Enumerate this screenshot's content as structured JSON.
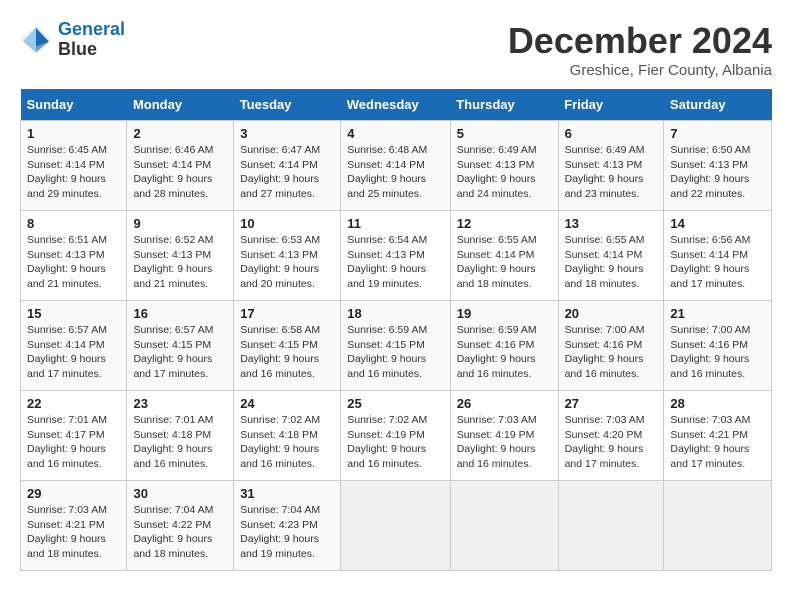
{
  "header": {
    "logo_line1": "General",
    "logo_line2": "Blue",
    "month_title": "December 2024",
    "subtitle": "Greshice, Fier County, Albania"
  },
  "days_of_week": [
    "Sunday",
    "Monday",
    "Tuesday",
    "Wednesday",
    "Thursday",
    "Friday",
    "Saturday"
  ],
  "weeks": [
    [
      {
        "day": "1",
        "info": "Sunrise: 6:45 AM\nSunset: 4:14 PM\nDaylight: 9 hours\nand 29 minutes."
      },
      {
        "day": "2",
        "info": "Sunrise: 6:46 AM\nSunset: 4:14 PM\nDaylight: 9 hours\nand 28 minutes."
      },
      {
        "day": "3",
        "info": "Sunrise: 6:47 AM\nSunset: 4:14 PM\nDaylight: 9 hours\nand 27 minutes."
      },
      {
        "day": "4",
        "info": "Sunrise: 6:48 AM\nSunset: 4:14 PM\nDaylight: 9 hours\nand 25 minutes."
      },
      {
        "day": "5",
        "info": "Sunrise: 6:49 AM\nSunset: 4:13 PM\nDaylight: 9 hours\nand 24 minutes."
      },
      {
        "day": "6",
        "info": "Sunrise: 6:49 AM\nSunset: 4:13 PM\nDaylight: 9 hours\nand 23 minutes."
      },
      {
        "day": "7",
        "info": "Sunrise: 6:50 AM\nSunset: 4:13 PM\nDaylight: 9 hours\nand 22 minutes."
      }
    ],
    [
      {
        "day": "8",
        "info": "Sunrise: 6:51 AM\nSunset: 4:13 PM\nDaylight: 9 hours\nand 21 minutes."
      },
      {
        "day": "9",
        "info": "Sunrise: 6:52 AM\nSunset: 4:13 PM\nDaylight: 9 hours\nand 21 minutes."
      },
      {
        "day": "10",
        "info": "Sunrise: 6:53 AM\nSunset: 4:13 PM\nDaylight: 9 hours\nand 20 minutes."
      },
      {
        "day": "11",
        "info": "Sunrise: 6:54 AM\nSunset: 4:13 PM\nDaylight: 9 hours\nand 19 minutes."
      },
      {
        "day": "12",
        "info": "Sunrise: 6:55 AM\nSunset: 4:14 PM\nDaylight: 9 hours\nand 18 minutes."
      },
      {
        "day": "13",
        "info": "Sunrise: 6:55 AM\nSunset: 4:14 PM\nDaylight: 9 hours\nand 18 minutes."
      },
      {
        "day": "14",
        "info": "Sunrise: 6:56 AM\nSunset: 4:14 PM\nDaylight: 9 hours\nand 17 minutes."
      }
    ],
    [
      {
        "day": "15",
        "info": "Sunrise: 6:57 AM\nSunset: 4:14 PM\nDaylight: 9 hours\nand 17 minutes."
      },
      {
        "day": "16",
        "info": "Sunrise: 6:57 AM\nSunset: 4:15 PM\nDaylight: 9 hours\nand 17 minutes."
      },
      {
        "day": "17",
        "info": "Sunrise: 6:58 AM\nSunset: 4:15 PM\nDaylight: 9 hours\nand 16 minutes."
      },
      {
        "day": "18",
        "info": "Sunrise: 6:59 AM\nSunset: 4:15 PM\nDaylight: 9 hours\nand 16 minutes."
      },
      {
        "day": "19",
        "info": "Sunrise: 6:59 AM\nSunset: 4:16 PM\nDaylight: 9 hours\nand 16 minutes."
      },
      {
        "day": "20",
        "info": "Sunrise: 7:00 AM\nSunset: 4:16 PM\nDaylight: 9 hours\nand 16 minutes."
      },
      {
        "day": "21",
        "info": "Sunrise: 7:00 AM\nSunset: 4:16 PM\nDaylight: 9 hours\nand 16 minutes."
      }
    ],
    [
      {
        "day": "22",
        "info": "Sunrise: 7:01 AM\nSunset: 4:17 PM\nDaylight: 9 hours\nand 16 minutes."
      },
      {
        "day": "23",
        "info": "Sunrise: 7:01 AM\nSunset: 4:18 PM\nDaylight: 9 hours\nand 16 minutes."
      },
      {
        "day": "24",
        "info": "Sunrise: 7:02 AM\nSunset: 4:18 PM\nDaylight: 9 hours\nand 16 minutes."
      },
      {
        "day": "25",
        "info": "Sunrise: 7:02 AM\nSunset: 4:19 PM\nDaylight: 9 hours\nand 16 minutes."
      },
      {
        "day": "26",
        "info": "Sunrise: 7:03 AM\nSunset: 4:19 PM\nDaylight: 9 hours\nand 16 minutes."
      },
      {
        "day": "27",
        "info": "Sunrise: 7:03 AM\nSunset: 4:20 PM\nDaylight: 9 hours\nand 17 minutes."
      },
      {
        "day": "28",
        "info": "Sunrise: 7:03 AM\nSunset: 4:21 PM\nDaylight: 9 hours\nand 17 minutes."
      }
    ],
    [
      {
        "day": "29",
        "info": "Sunrise: 7:03 AM\nSunset: 4:21 PM\nDaylight: 9 hours\nand 18 minutes."
      },
      {
        "day": "30",
        "info": "Sunrise: 7:04 AM\nSunset: 4:22 PM\nDaylight: 9 hours\nand 18 minutes."
      },
      {
        "day": "31",
        "info": "Sunrise: 7:04 AM\nSunset: 4:23 PM\nDaylight: 9 hours\nand 19 minutes."
      },
      {
        "day": "",
        "info": ""
      },
      {
        "day": "",
        "info": ""
      },
      {
        "day": "",
        "info": ""
      },
      {
        "day": "",
        "info": ""
      }
    ]
  ]
}
